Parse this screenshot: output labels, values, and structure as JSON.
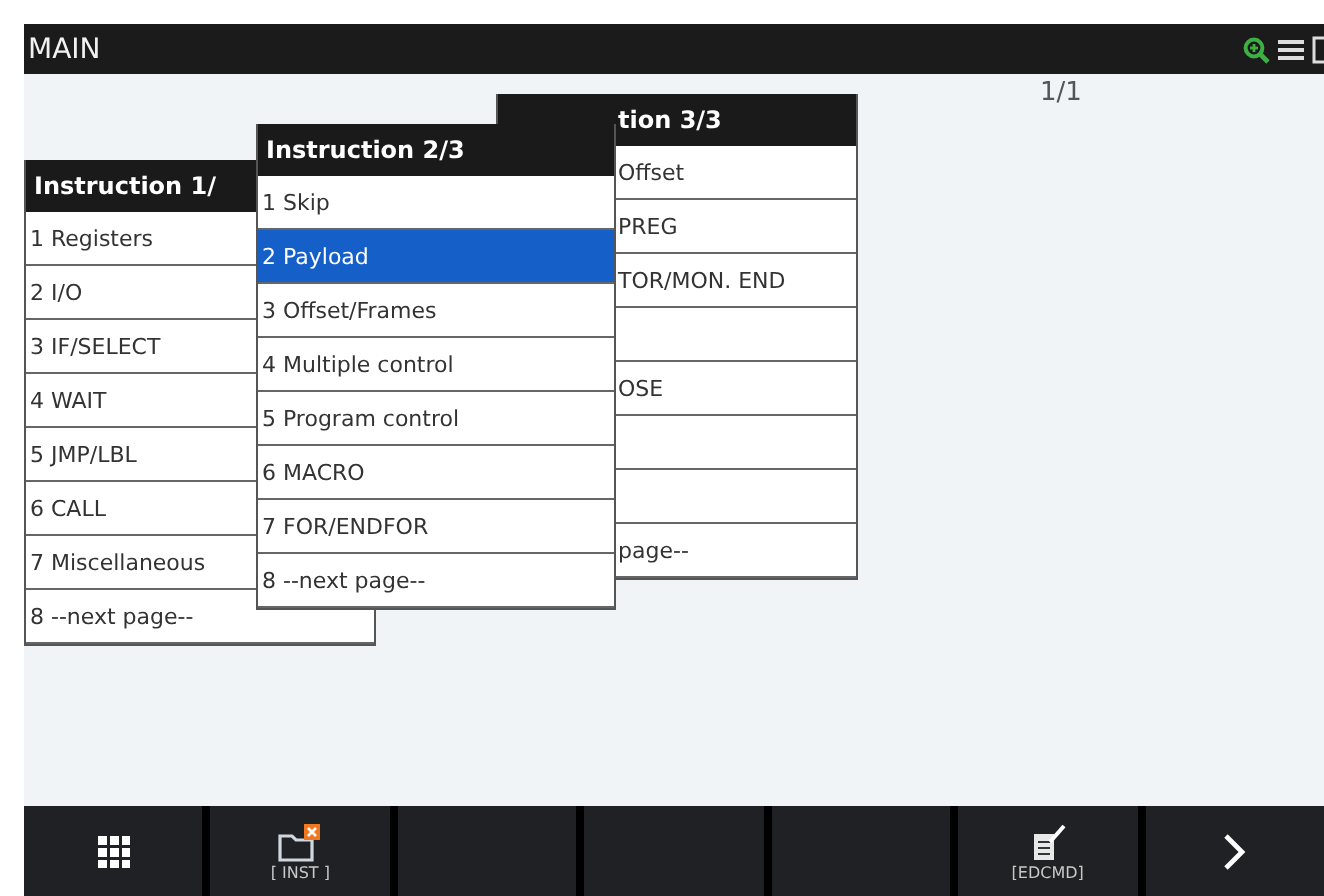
{
  "title_bar": {
    "title": "MAIN"
  },
  "page_indicator": "1/1",
  "menus": [
    {
      "title": "Instruction 1/",
      "items": [
        {
          "label": "1 Registers",
          "selected": false
        },
        {
          "label": "2 I/O",
          "selected": false
        },
        {
          "label": "3 IF/SELECT",
          "selected": false
        },
        {
          "label": "4 WAIT",
          "selected": false
        },
        {
          "label": "5 JMP/LBL",
          "selected": false
        },
        {
          "label": "6 CALL",
          "selected": false
        },
        {
          "label": "7 Miscellaneous",
          "selected": false
        },
        {
          "label": "8 --next page--",
          "selected": false
        }
      ]
    },
    {
      "title": "Instruction 2/3",
      "items": [
        {
          "label": "1 Skip",
          "selected": false
        },
        {
          "label": "2 Payload",
          "selected": true
        },
        {
          "label": "3 Offset/Frames",
          "selected": false
        },
        {
          "label": "4 Multiple control",
          "selected": false
        },
        {
          "label": "5 Program control",
          "selected": false
        },
        {
          "label": "6 MACRO",
          "selected": false
        },
        {
          "label": "7 FOR/ENDFOR",
          "selected": false
        },
        {
          "label": "8 --next page--",
          "selected": false
        }
      ]
    },
    {
      "title": "tion 3/3",
      "items": [
        {
          "label": "Offset",
          "selected": false
        },
        {
          "label": "PREG",
          "selected": false
        },
        {
          "label": "TOR/MON. END",
          "selected": false
        },
        {
          "selected": false
        },
        {
          "label": "OSE",
          "selected": false
        },
        {
          "selected": false
        },
        {
          "selected": false
        },
        {
          "label": "page--",
          "selected": false
        }
      ]
    }
  ],
  "function_keys": [
    {
      "kind": "grid"
    },
    {
      "kind": "inst",
      "label": "[ INST ]"
    },
    {
      "kind": "blank"
    },
    {
      "kind": "blank"
    },
    {
      "kind": "blank"
    },
    {
      "kind": "edcmd",
      "label": "[EDCMD]"
    },
    {
      "kind": "next"
    }
  ]
}
